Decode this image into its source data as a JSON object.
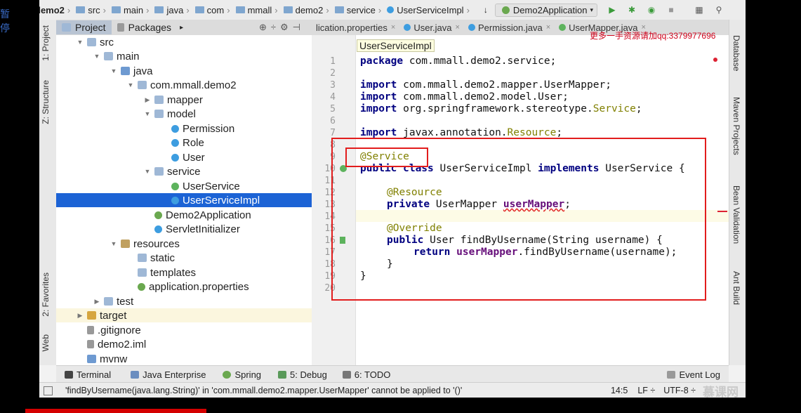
{
  "overlay": {
    "side_text": "暂停"
  },
  "navbar": {
    "crumbs": [
      "demo2",
      "src",
      "main",
      "java",
      "com",
      "mmall",
      "demo2",
      "service",
      "UserServiceImpl"
    ],
    "run_config": "Demo2Application"
  },
  "left_strip": {
    "tabs": [
      "1: Project",
      "Z: Structure",
      "2: Favorites",
      "Web"
    ]
  },
  "right_strip": {
    "tabs": [
      "Database",
      "Maven Projects",
      "Bean Validation",
      "Ant Build"
    ]
  },
  "project_panel": {
    "tab_project": "Project",
    "tab_packages": "Packages"
  },
  "tree": [
    {
      "label": "src",
      "icon": "folder-icon"
    },
    {
      "label": "main",
      "icon": "folder-icon"
    },
    {
      "label": "java",
      "icon": "source-folder-icon"
    },
    {
      "label": "com.mmall.demo2",
      "icon": "package-icon"
    },
    {
      "label": "mapper",
      "icon": "package-icon"
    },
    {
      "label": "model",
      "icon": "package-icon"
    },
    {
      "label": "Permission",
      "icon": "class-icon"
    },
    {
      "label": "Role",
      "icon": "class-icon"
    },
    {
      "label": "User",
      "icon": "class-icon"
    },
    {
      "label": "service",
      "icon": "package-icon"
    },
    {
      "label": "UserService",
      "icon": "interface-icon"
    },
    {
      "label": "UserServiceImpl",
      "icon": "class-icon"
    },
    {
      "label": "Demo2Application",
      "icon": "spring-boot-icon"
    },
    {
      "label": "ServletInitializer",
      "icon": "class-icon"
    },
    {
      "label": "resources",
      "icon": "resources-folder-icon"
    },
    {
      "label": "static",
      "icon": "folder-icon"
    },
    {
      "label": "templates",
      "icon": "folder-icon"
    },
    {
      "label": "application.properties",
      "icon": "properties-icon"
    },
    {
      "label": "test",
      "icon": "folder-icon"
    },
    {
      "label": "target",
      "icon": "target-folder-icon"
    },
    {
      "label": ".gitignore",
      "icon": "gitignore-icon"
    },
    {
      "label": "demo2.iml",
      "icon": "iml-file-icon"
    },
    {
      "label": "mvnw",
      "icon": "script-file-icon"
    }
  ],
  "editor_tabs": [
    "lication.properties",
    "User.java",
    "Permission.java",
    "UserMapper.java"
  ],
  "watermark": "更多一手资源请加qq:3379977696",
  "editor": {
    "breadcrumb_tip": "UserServiceImpl",
    "line_numbers": [
      "1",
      "2",
      "3",
      "4",
      "5",
      "6",
      "7",
      "8",
      "9",
      "10",
      "11",
      "12",
      "13",
      "14",
      "15",
      "16",
      "17",
      "18",
      "19",
      "20"
    ],
    "lines": {
      "l1_kw": "package",
      "l1_rest": " com.mmall.demo2.service;",
      "l3_kw": "import",
      "l3_rest": " com.mmall.demo2.mapper.UserMapper;",
      "l4_kw": "import",
      "l4_rest": " com.mmall.demo2.model.User;",
      "l5_kw": "import",
      "l5_rest": " org.springframework.stereotype.",
      "l5_cls": "Service",
      "l5_end": ";",
      "l7_kw": "import",
      "l7_rest": " javax.annotation.",
      "l7_cls": "Resource",
      "l7_end": ";",
      "l9_an": "@Service",
      "l10_kw1": "public class",
      "l10_mid": " UserServiceImpl ",
      "l10_kw2": "implements",
      "l10_end": " UserService {",
      "l12_an": "@Resource",
      "l13_kw": "private",
      "l13_mid": " UserMapper ",
      "l13_fld": "userMapper",
      "l13_end": ";",
      "l15_an": "@Override",
      "l16_kw": "public",
      "l16_rest": " User findByUsername(String username) {",
      "l17_kw": "return",
      "l17_sp": " ",
      "l17_fld": "userMapper",
      "l17_rest": ".findByUsername(username);",
      "l18": "}",
      "l19": "}"
    }
  },
  "tool_windows": [
    "Terminal",
    "Java Enterprise",
    "Spring",
    "5: Debug",
    "6: TODO"
  ],
  "event_log": "Event Log",
  "status": {
    "message": "'findByUsername(java.lang.String)' in 'com.mmall.demo2.mapper.UserMapper' cannot be applied to '()'",
    "position": "14:5",
    "line_sep": "LF ÷",
    "encoding": "UTF-8 ÷",
    "logo": "慕课网"
  },
  "colors": {
    "accent": "#1c63d5",
    "highlight_box": "#e21d1d"
  }
}
